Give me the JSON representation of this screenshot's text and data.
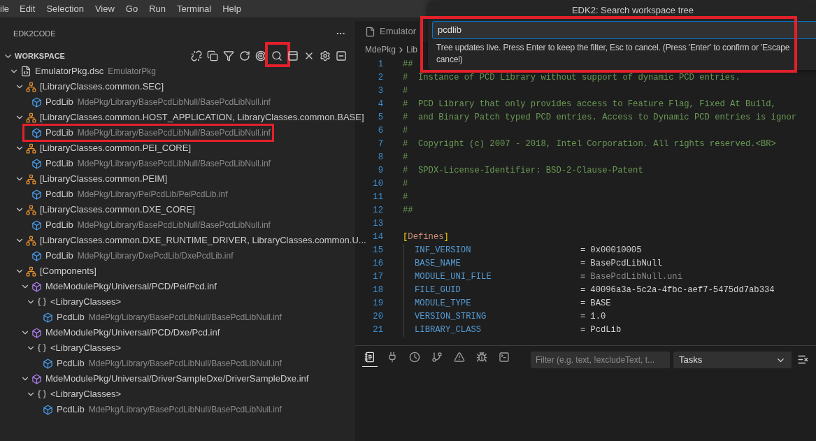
{
  "menu_bar": [
    "ile",
    "Edit",
    "Selection",
    "View",
    "Go",
    "Run",
    "Terminal",
    "Help"
  ],
  "sidebar": {
    "title": "EDK2CODE",
    "more": "···",
    "section": "WORKSPACE",
    "toolbar": [
      {
        "kind": "unlink",
        "highlighted": false
      },
      {
        "kind": "copy",
        "highlighted": false
      },
      {
        "kind": "filter",
        "highlighted": false
      },
      {
        "kind": "refresh",
        "highlighted": false
      },
      {
        "kind": "target",
        "highlighted": false
      },
      {
        "kind": "search",
        "highlighted": true
      },
      {
        "kind": "panel",
        "highlighted": false
      },
      {
        "kind": "close",
        "highlighted": false
      },
      {
        "kind": "settings",
        "highlighted": false
      },
      {
        "kind": "collapse",
        "highlighted": false
      }
    ],
    "tree": [
      {
        "kind": "dsc",
        "label": "EmulatorPkg.dsc",
        "description": "EmulatorPkg",
        "expanded": true,
        "highlighted": false,
        "children": [
          {
            "kind": "section",
            "label": "[LibraryClasses.common.SEC]",
            "expanded": true,
            "highlighted": false,
            "children": [
              {
                "kind": "library",
                "label": "PcdLib",
                "description": "MdePkg/Library/BasePcdLibNull/BasePcdLibNull.inf",
                "highlighted": false
              }
            ]
          },
          {
            "kind": "section",
            "label": "[LibraryClasses.common.HOST_APPLICATION, LibraryClasses.common.BASE]",
            "expanded": true,
            "highlighted": false,
            "children": [
              {
                "kind": "library",
                "label": "PcdLib",
                "description": "MdePkg/Library/BasePcdLibNull/BasePcdLibNull.inf",
                "highlighted": true
              }
            ]
          },
          {
            "kind": "section",
            "label": "[LibraryClasses.common.PEI_CORE]",
            "expanded": true,
            "highlighted": false,
            "children": [
              {
                "kind": "library",
                "label": "PcdLib",
                "description": "MdePkg/Library/BasePcdLibNull/BasePcdLibNull.inf",
                "highlighted": false
              }
            ]
          },
          {
            "kind": "section",
            "label": "[LibraryClasses.common.PEIM]",
            "expanded": true,
            "highlighted": false,
            "children": [
              {
                "kind": "library",
                "label": "PcdLib",
                "description": "MdePkg/Library/PeiPcdLib/PeiPcdLib.inf",
                "highlighted": false
              }
            ]
          },
          {
            "kind": "section",
            "label": "[LibraryClasses.common.DXE_CORE]",
            "expanded": true,
            "highlighted": false,
            "children": [
              {
                "kind": "library",
                "label": "PcdLib",
                "description": "MdePkg/Library/BasePcdLibNull/BasePcdLibNull.inf",
                "highlighted": false
              }
            ]
          },
          {
            "kind": "section",
            "label": "[LibraryClasses.common.DXE_RUNTIME_DRIVER, LibraryClasses.common.U...",
            "expanded": true,
            "highlighted": false,
            "children": [
              {
                "kind": "library",
                "label": "PcdLib",
                "description": "MdePkg/Library/DxePcdLib/DxePcdLib.inf",
                "highlighted": false
              }
            ]
          },
          {
            "kind": "section",
            "label": "[Components]",
            "expanded": true,
            "highlighted": false,
            "children": [
              {
                "kind": "module",
                "label": "MdeModulePkg/Universal/PCD/Pei/Pcd.inf",
                "expanded": true,
                "highlighted": false,
                "children": [
                  {
                    "kind": "group",
                    "label": "<LibraryClasses>",
                    "expanded": true,
                    "highlighted": false,
                    "children": [
                      {
                        "kind": "library",
                        "label": "PcdLib",
                        "description": "MdePkg/Library/BasePcdLibNull/BasePcdLibNull.inf",
                        "highlighted": false
                      }
                    ]
                  }
                ]
              },
              {
                "kind": "module",
                "label": "MdeModulePkg/Universal/PCD/Dxe/Pcd.inf",
                "expanded": true,
                "highlighted": false,
                "children": [
                  {
                    "kind": "group",
                    "label": "<LibraryClasses>",
                    "expanded": true,
                    "highlighted": false,
                    "children": [
                      {
                        "kind": "library",
                        "label": "PcdLib",
                        "description": "MdePkg/Library/BasePcdLibNull/BasePcdLibNull.inf",
                        "highlighted": false
                      }
                    ]
                  }
                ]
              },
              {
                "kind": "module",
                "label": "MdeModulePkg/Universal/DriverSampleDxe/DriverSampleDxe.inf",
                "expanded": true,
                "highlighted": false,
                "children": [
                  {
                    "kind": "group",
                    "label": "<LibraryClasses>",
                    "expanded": true,
                    "highlighted": false,
                    "children": [
                      {
                        "kind": "library",
                        "label": "PcdLib",
                        "description": "MdePkg/Library/BasePcdLibNull/BasePcdLibNull.inf",
                        "highlighted": false
                      }
                    ]
                  }
                ]
              }
            ]
          }
        ]
      }
    ]
  },
  "editor": {
    "tab": "Emulator",
    "breadcrumb": [
      "MdePkg",
      "Lib"
    ],
    "lines": [
      {
        "number": "1",
        "kind": "comment",
        "text": "##"
      },
      {
        "number": "2",
        "kind": "comment",
        "text": "#  Instance of PCD Library without support of dynamic PCD entries."
      },
      {
        "number": "3",
        "kind": "comment",
        "text": "#"
      },
      {
        "number": "4",
        "kind": "comment",
        "text": "#  PCD Library that only provides access to Feature Flag, Fixed At Build,"
      },
      {
        "number": "5",
        "kind": "comment",
        "text": "#  and Binary Patch typed PCD entries. Access to Dynamic PCD entries is ignor"
      },
      {
        "number": "6",
        "kind": "comment",
        "text": "#"
      },
      {
        "number": "7",
        "kind": "comment",
        "text": "#  Copyright (c) 2007 - 2018, Intel Corporation. All rights reserved.<BR>"
      },
      {
        "number": "8",
        "kind": "comment",
        "text": "#"
      },
      {
        "number": "9",
        "kind": "comment",
        "text": "#  SPDX-License-Identifier: BSD-2-Clause-Patent"
      },
      {
        "number": "10",
        "kind": "comment",
        "text": "#"
      },
      {
        "number": "11",
        "kind": "comment",
        "text": "#"
      },
      {
        "number": "12",
        "kind": "comment",
        "text": "##"
      },
      {
        "number": "13",
        "kind": "blank"
      },
      {
        "number": "14",
        "kind": "section",
        "open": "[",
        "name": "Defines",
        "close": "]"
      },
      {
        "number": "15",
        "kind": "define",
        "key": "INF_VERSION",
        "equals": "=",
        "value": "0x00010005",
        "dim": false
      },
      {
        "number": "16",
        "kind": "define",
        "key": "BASE_NAME",
        "equals": "=",
        "value": "BasePcdLibNull",
        "dim": false
      },
      {
        "number": "17",
        "kind": "define",
        "key": "MODULE_UNI_FILE",
        "equals": "=",
        "value": "BasePcdLibNull.uni",
        "dim": true
      },
      {
        "number": "18",
        "kind": "define",
        "key": "FILE_GUID",
        "equals": "=",
        "value": "40096a3a-5c2a-4fbc-aef7-5475dd7ab334",
        "dim": false
      },
      {
        "number": "19",
        "kind": "define",
        "key": "MODULE_TYPE",
        "equals": "=",
        "value": "BASE",
        "dim": false
      },
      {
        "number": "20",
        "kind": "define",
        "key": "VERSION_STRING",
        "equals": "=",
        "value": "1.0",
        "dim": false
      },
      {
        "number": "21",
        "kind": "define",
        "key": "LIBRARY_CLASS",
        "equals": "=",
        "value": "PcdLib",
        "dim": false
      }
    ]
  },
  "quick_input": {
    "title": "EDK2: Search workspace tree",
    "value": "pcdlib",
    "message": [
      "Tree updates live. Press Enter to keep the filter, Esc to cancel. (Press 'Enter' to confirm or 'Escape",
      "cancel)"
    ],
    "highlighted": true
  },
  "panel": {
    "tabs": [
      {
        "kind": "notes",
        "selected": true
      },
      {
        "kind": "plug",
        "selected": false
      },
      {
        "kind": "clock",
        "selected": false
      },
      {
        "kind": "branch",
        "selected": false
      },
      {
        "kind": "warning",
        "selected": false
      },
      {
        "kind": "debug-terminal",
        "selected": false
      },
      {
        "kind": "terminal",
        "selected": false
      }
    ],
    "filter": {
      "placeholder": "Filter (e.g. text, !excludeText, t..."
    },
    "select": "Tasks"
  }
}
